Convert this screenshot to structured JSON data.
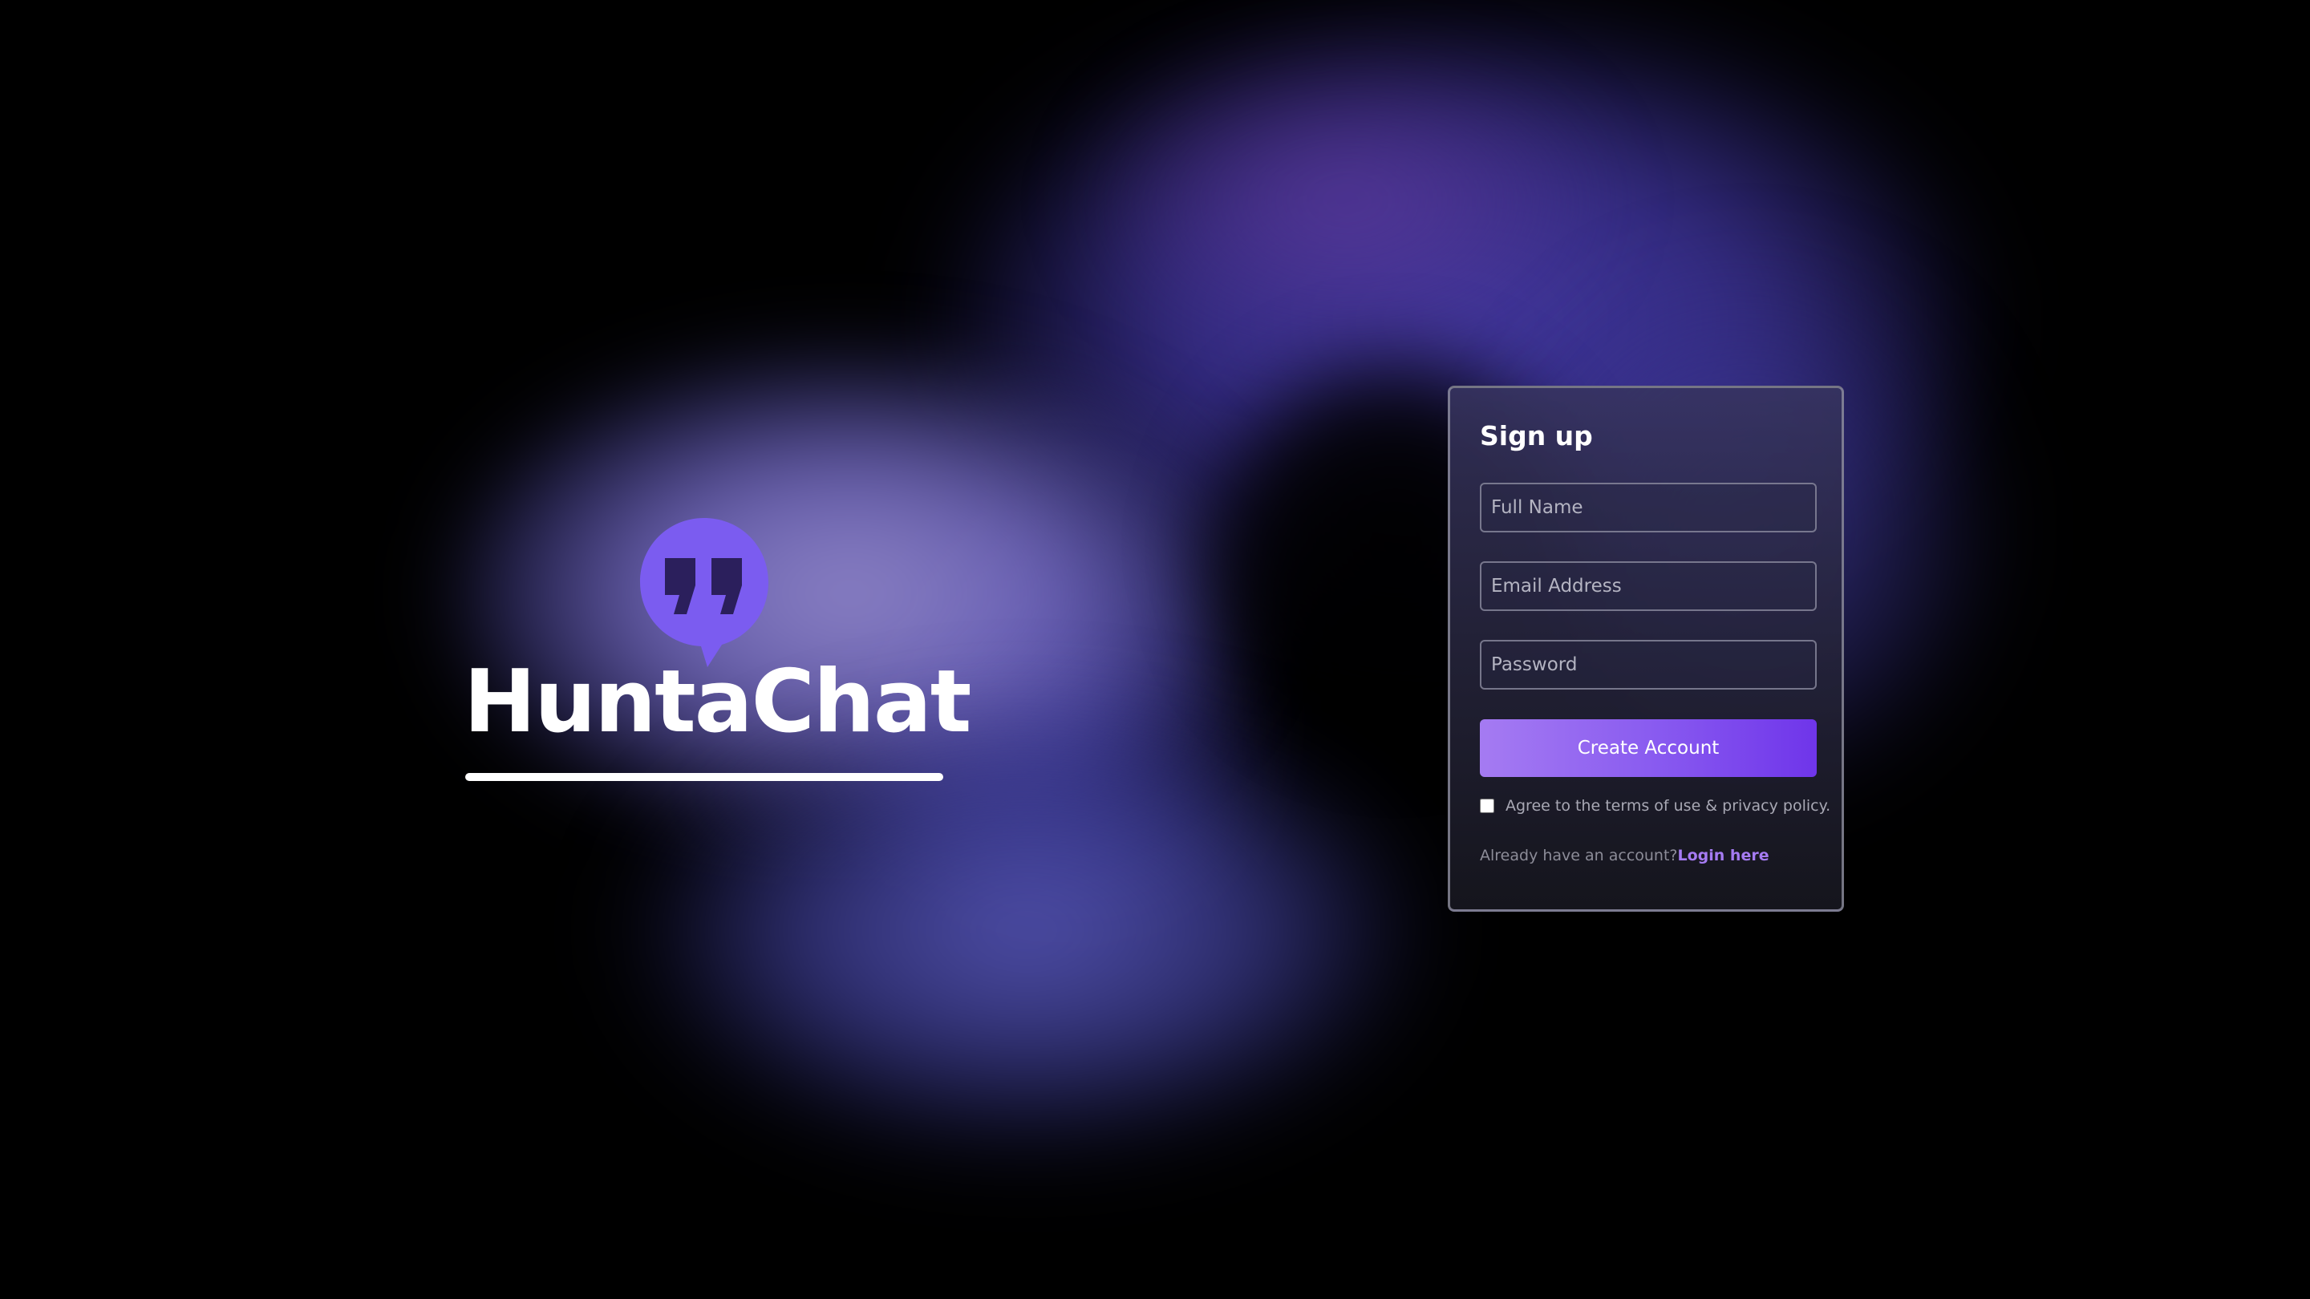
{
  "brand": {
    "name": "HuntaChat",
    "logo_icon": "quote-chat-bubble-icon",
    "logo_color": "#7b5cf0"
  },
  "signup": {
    "title": "Sign up",
    "full_name_placeholder": "Full Name",
    "email_placeholder": "Email Address",
    "password_placeholder": "Password",
    "create_account_label": "Create Account",
    "terms_label": "Agree to the terms of use & privacy policy.",
    "terms_checked": false,
    "login_prompt": "Already have an account?",
    "login_link_label": "Login here"
  },
  "colors": {
    "accent": "#8a5cf0",
    "accent_light": "#a57bf2",
    "background": "#000000"
  }
}
